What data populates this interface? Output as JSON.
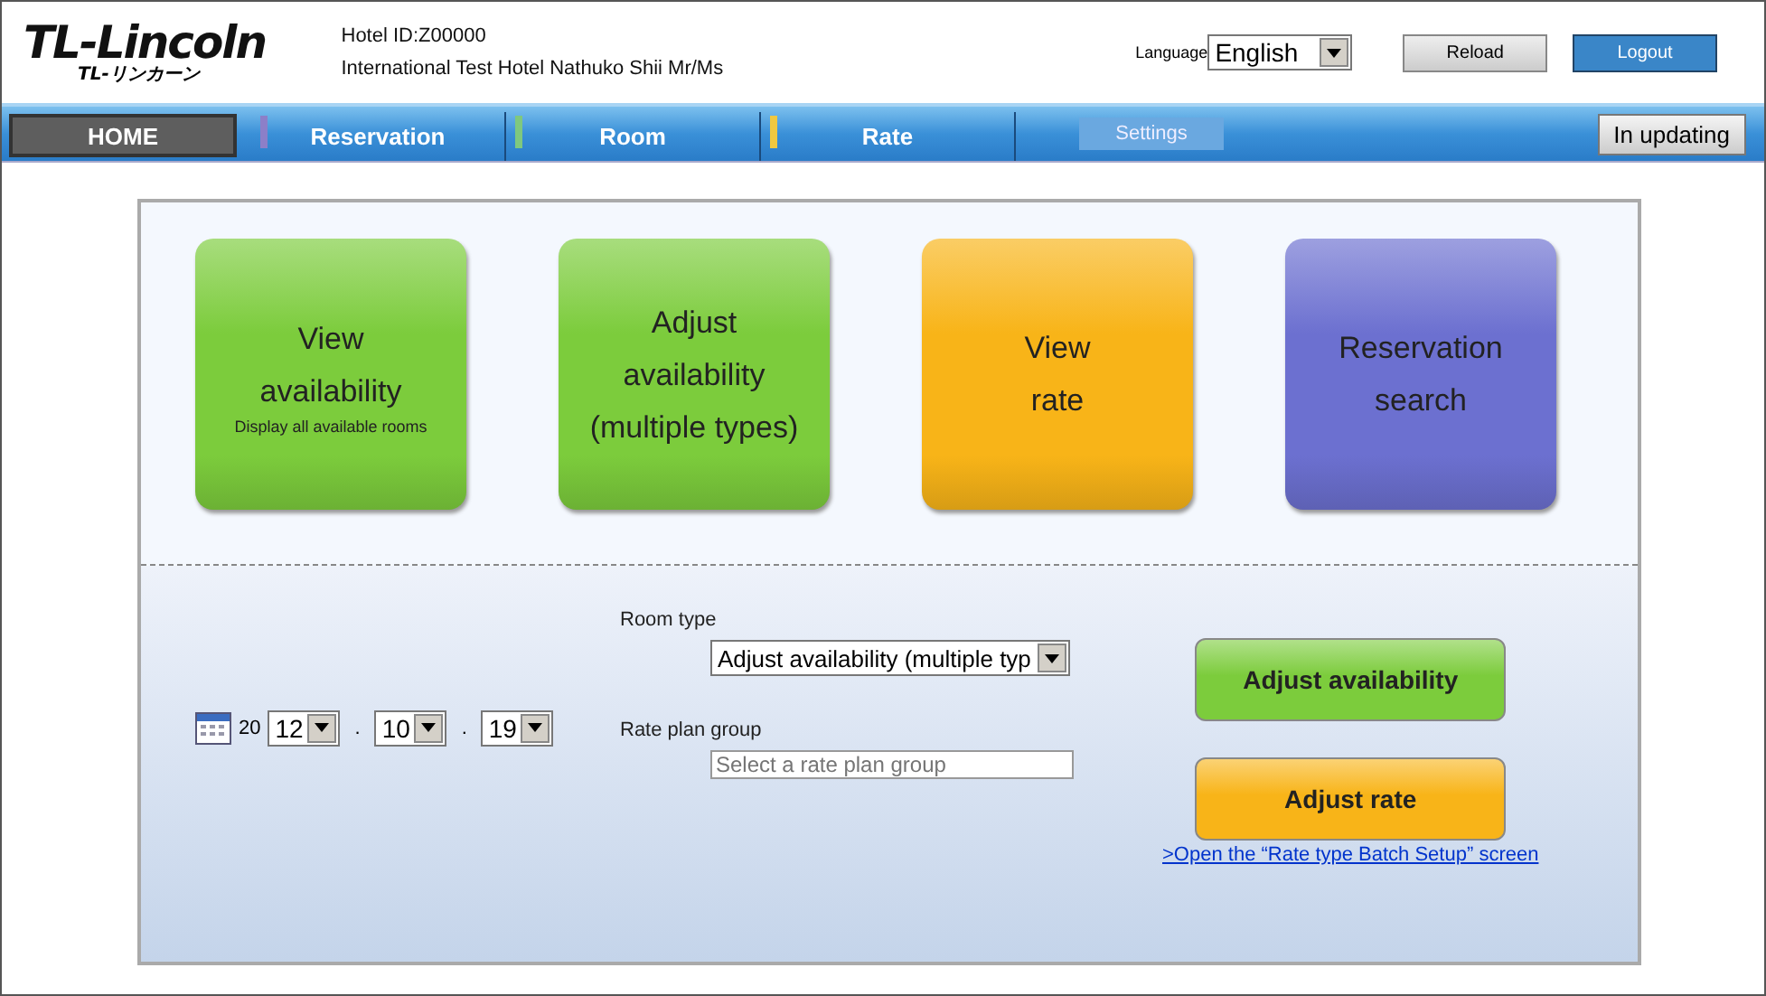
{
  "logo": {
    "name": "TL-Lincoln",
    "subtitle": "TL-リンカーン"
  },
  "hotel": {
    "id_label": "Hotel ID:",
    "id": "Z00000",
    "name": "International Test Hotel",
    "user": "Nathuko Shii Mr/Ms"
  },
  "language": {
    "label": "Language",
    "value": "English"
  },
  "buttons": [
    {
      "label": "Reload",
      "kind": "plain"
    },
    {
      "label": "Logout",
      "kind": "primary"
    }
  ],
  "nav": [
    {
      "label": "HOME",
      "kind": "tab",
      "selected": true
    },
    {
      "label": "Reservation",
      "kind": "tab",
      "selected": false,
      "color": "#8c7fc8"
    },
    {
      "label": "Room",
      "kind": "tab",
      "selected": false,
      "color": "#7fc87f"
    },
    {
      "label": "Rate",
      "kind": "tab",
      "selected": false,
      "color": "#f0c840"
    },
    {
      "label": "Settings",
      "kind": "pill",
      "selected": false
    }
  ],
  "status": "In updating",
  "tiles": [
    {
      "lines": [
        "View",
        "availability"
      ],
      "note": "Display all available rooms",
      "color": "#7ccc3c"
    },
    {
      "lines": [
        "Adjust",
        "availability",
        "(multiple types)"
      ],
      "color": "#7ccc3c"
    },
    {
      "lines": [
        "View",
        "rate"
      ],
      "color": "#f8b418"
    },
    {
      "lines": [
        "Reservation",
        "search"
      ],
      "color": "#6c70d0"
    }
  ],
  "date": {
    "prefix": "20",
    "fields": [
      "12",
      "10",
      "19"
    ],
    "separator": "."
  },
  "room_type": {
    "label": "Room type",
    "value": "Adjust availability (multiple typ"
  },
  "rate_plan": {
    "label": "Rate plan group",
    "placeholder": "Select a rate plan group"
  },
  "actions": [
    {
      "label": "Adjust availability",
      "color": "#7ccc3c"
    },
    {
      "label": "Adjust rate",
      "color": "#f8b418"
    }
  ],
  "link": ">Open the “Rate type Batch Setup” screen"
}
